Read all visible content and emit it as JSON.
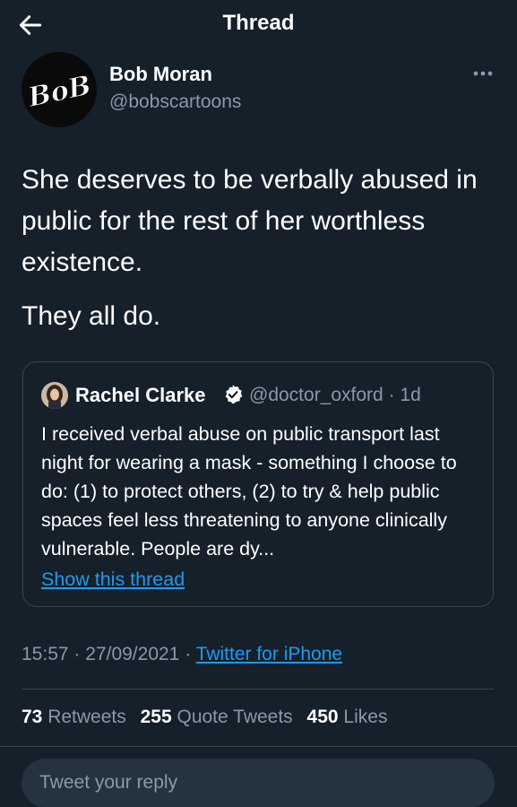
{
  "header": {
    "title": "Thread",
    "back_icon": "arrow-left-icon"
  },
  "tweet": {
    "author_name": "Bob Moran",
    "author_handle": "@bobscartoons",
    "avatar_text": "BoB",
    "more_icon": "more-horizontal-icon",
    "text_lines": [
      "She deserves to be verbally abused in public for the rest of her worthless existence.",
      "They all do."
    ],
    "time": "15:57",
    "date": "27/09/2021",
    "source": "Twitter for iPhone",
    "separator": "·"
  },
  "quoted_tweet": {
    "author_name": "Rachel Clarke",
    "verified_icon": "verified-badge-icon",
    "author_handle": "@doctor_oxford",
    "age": "1d",
    "text": "I received verbal abuse on public transport last night for wearing a mask - something I choose to do: (1) to protect others, (2) to try & help public spaces feel less threatening to anyone clinically vulnerable. People are dy...",
    "show_thread_label": "Show this thread"
  },
  "stats": {
    "retweets_count": "73",
    "retweets_label": "Retweets",
    "quotes_count": "255",
    "quotes_label": "Quote Tweets",
    "likes_count": "450",
    "likes_label": "Likes"
  },
  "reply": {
    "placeholder": "Tweet your reply"
  },
  "colors": {
    "background": "#15202b",
    "accent": "#1d9bf0",
    "secondary_text": "#8b98a5",
    "border": "#38444d"
  }
}
